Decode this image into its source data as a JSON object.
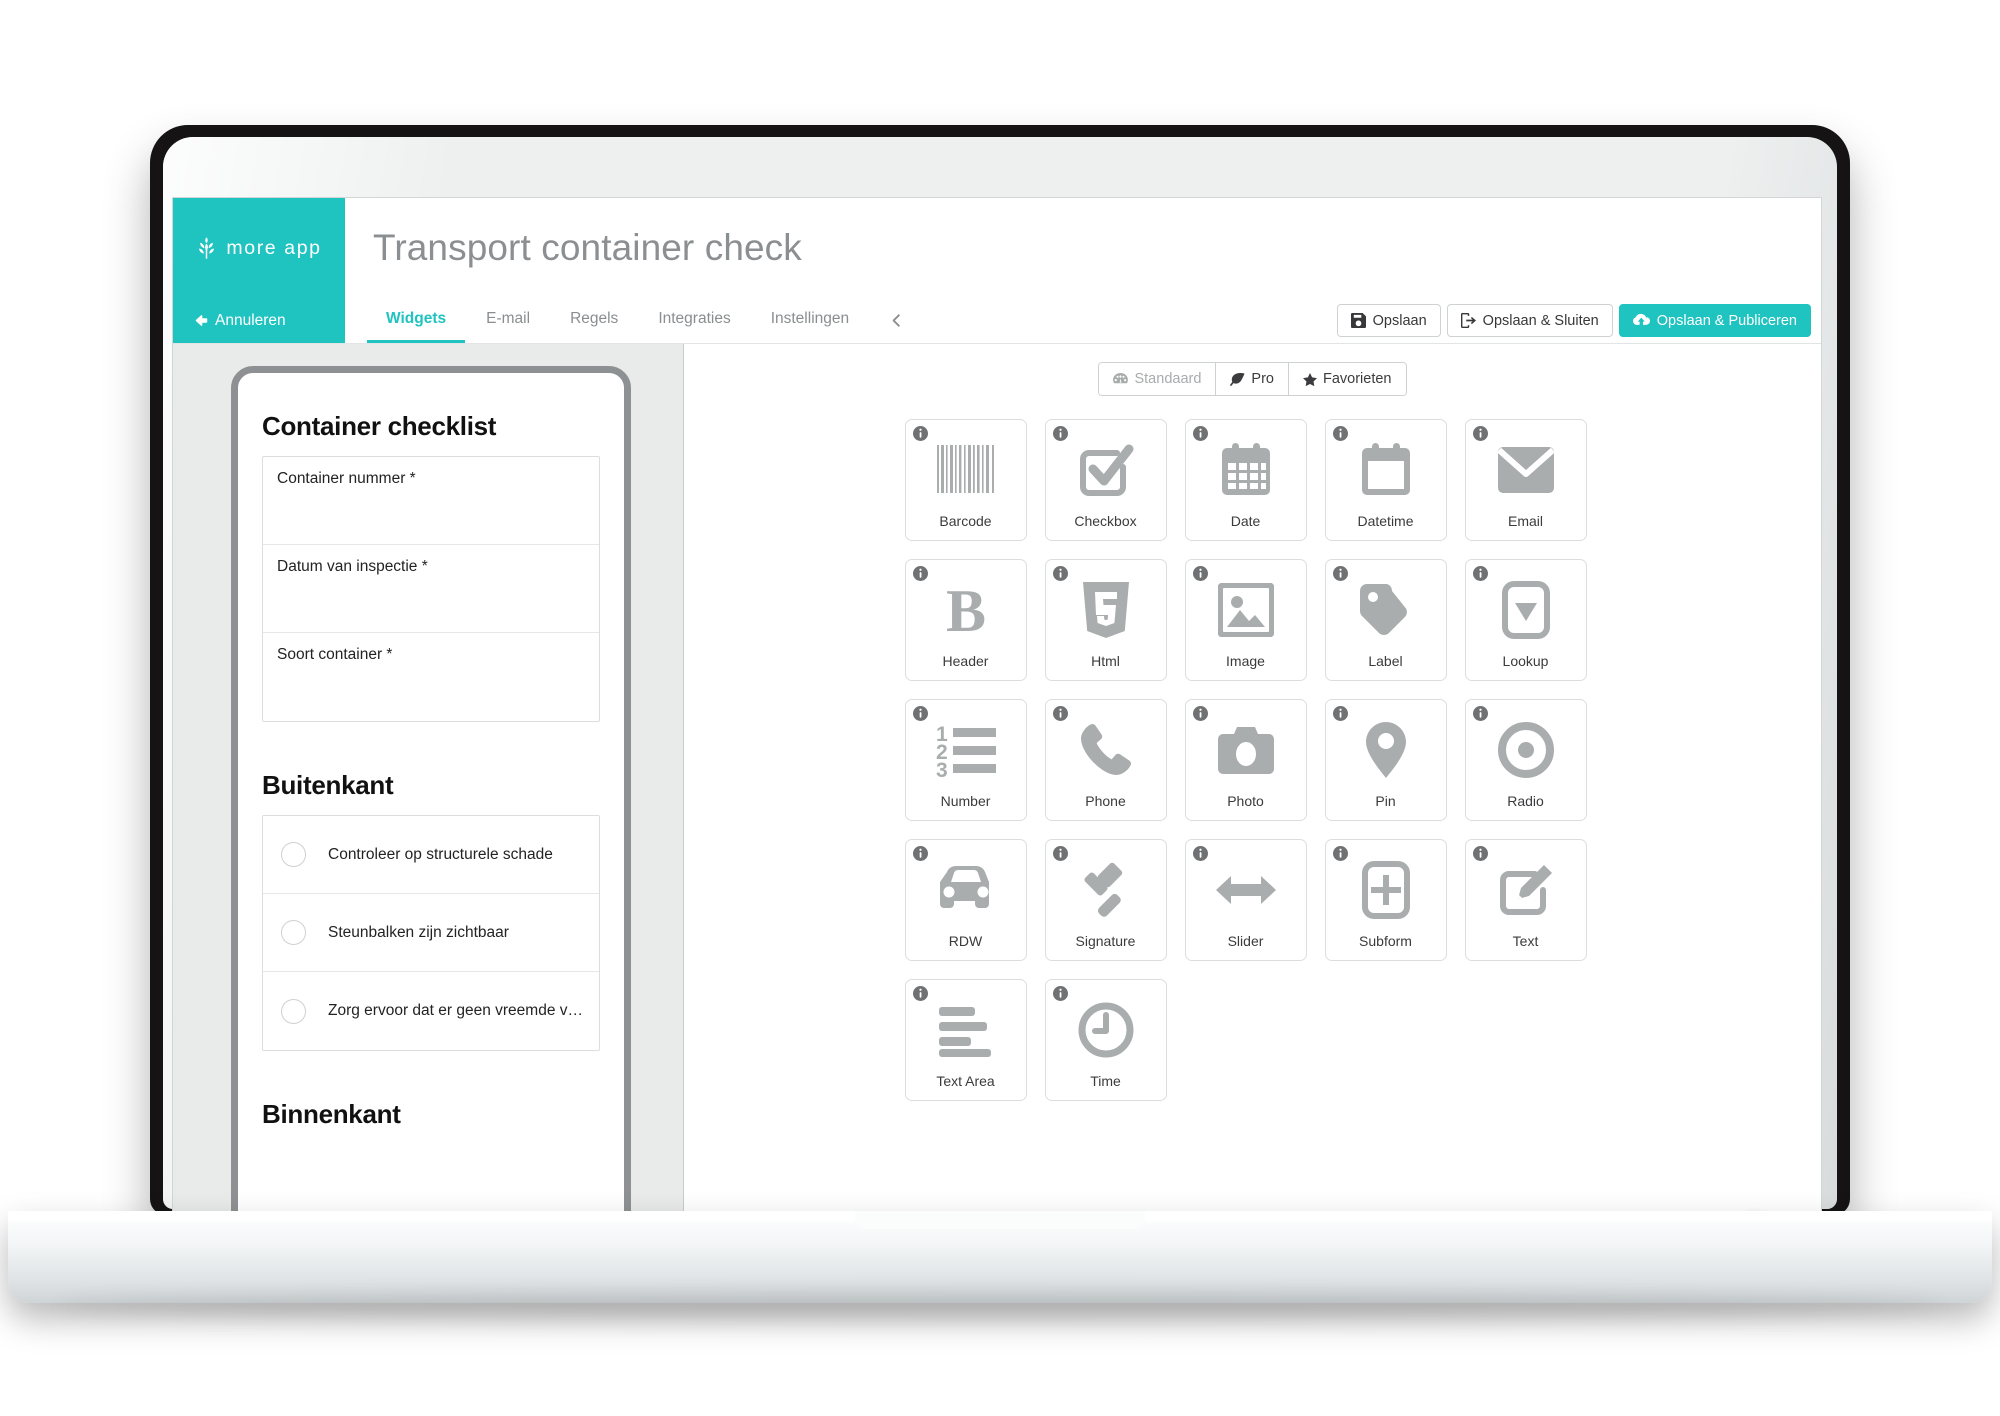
{
  "brand": {
    "name": "more app",
    "logo_icon": "wheat-sprig-icon",
    "color": "#1fc3c0"
  },
  "header": {
    "form_title": "Transport container check"
  },
  "nav": {
    "cancel_label": "Annuleren",
    "cancel_icon": "arrow-left-icon",
    "collapse_icon": "chevron-left-icon",
    "tabs": [
      {
        "label": "Widgets",
        "active": true
      },
      {
        "label": "E-mail",
        "active": false
      },
      {
        "label": "Regels",
        "active": false
      },
      {
        "label": "Integraties",
        "active": false
      },
      {
        "label": "Instellingen",
        "active": false
      }
    ],
    "actions": [
      {
        "label": "Opslaan",
        "icon": "floppy-disk-icon",
        "primary": false
      },
      {
        "label": "Opslaan & Sluiten",
        "icon": "sign-out-icon",
        "primary": false
      },
      {
        "label": "Opslaan & Publiceren",
        "icon": "cloud-upload-icon",
        "primary": true
      }
    ]
  },
  "preview": {
    "sections": [
      {
        "title": "Container checklist",
        "type": "fields",
        "fields": [
          {
            "label": "Container nummer *"
          },
          {
            "label": "Datum van inspectie *"
          },
          {
            "label": "Soort container *"
          }
        ]
      },
      {
        "title": "Buitenkant",
        "type": "checklist",
        "items": [
          {
            "label": "Controleer op structurele schade"
          },
          {
            "label": "Steunbalken zijn zichtbaar"
          },
          {
            "label": "Zorg ervoor dat er geen vreemde voorwerpen o…"
          }
        ]
      },
      {
        "title": "Binnenkant",
        "type": "heading-only"
      }
    ]
  },
  "palette": {
    "filters": [
      {
        "label": "Standaard",
        "icon": "dashboard-icon",
        "muted": true
      },
      {
        "label": "Pro",
        "icon": "leaf-icon",
        "muted": false
      },
      {
        "label": "Favorieten",
        "icon": "star-icon",
        "muted": false
      }
    ],
    "info_icon": "info-circle-icon",
    "widgets": [
      {
        "label": "Barcode",
        "icon": "barcode-icon"
      },
      {
        "label": "Checkbox",
        "icon": "checkbox-icon"
      },
      {
        "label": "Date",
        "icon": "calendar-icon"
      },
      {
        "label": "Datetime",
        "icon": "calendar-blank-icon"
      },
      {
        "label": "Email",
        "icon": "envelope-icon"
      },
      {
        "label": "Header",
        "icon": "bold-b-icon"
      },
      {
        "label": "Html",
        "icon": "html5-shield-icon"
      },
      {
        "label": "Image",
        "icon": "picture-icon"
      },
      {
        "label": "Label",
        "icon": "tag-icon"
      },
      {
        "label": "Lookup",
        "icon": "dropdown-icon"
      },
      {
        "label": "Number",
        "icon": "numbered-list-icon"
      },
      {
        "label": "Phone",
        "icon": "phone-icon"
      },
      {
        "label": "Photo",
        "icon": "camera-icon"
      },
      {
        "label": "Pin",
        "icon": "map-pin-icon"
      },
      {
        "label": "Radio",
        "icon": "radio-button-icon"
      },
      {
        "label": "RDW",
        "icon": "car-icon"
      },
      {
        "label": "Signature",
        "icon": "gavel-icon"
      },
      {
        "label": "Slider",
        "icon": "arrows-horizontal-icon"
      },
      {
        "label": "Subform",
        "icon": "plus-square-icon"
      },
      {
        "label": "Text",
        "icon": "pencil-square-icon"
      },
      {
        "label": "Text Area",
        "icon": "text-lines-icon"
      },
      {
        "label": "Time",
        "icon": "clock-icon"
      }
    ]
  },
  "chat": {
    "icon": "chat-bubble-icon",
    "color": "#27c2bf"
  }
}
